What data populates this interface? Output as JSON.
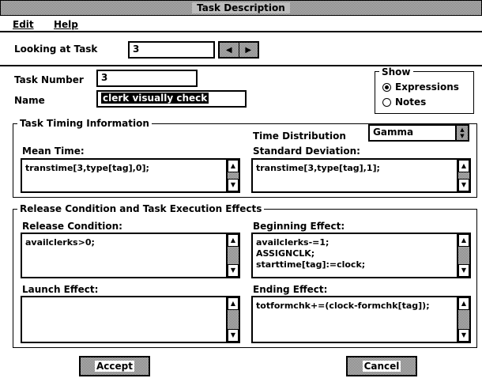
{
  "window": {
    "title": "Task Description"
  },
  "menu": {
    "edit": "Edit",
    "help": "Help"
  },
  "looking": {
    "label": "Looking at Task",
    "value": "3"
  },
  "task_number": {
    "label": "Task Number",
    "value": "3"
  },
  "name": {
    "label": "Name",
    "value": "clerk visually check"
  },
  "show": {
    "label": "Show",
    "options": [
      "Expressions",
      "Notes"
    ],
    "selected": "Expressions"
  },
  "timing": {
    "title": "Task Timing Information",
    "dist_label": "Time Distribution",
    "dist_value": "Gamma",
    "mean_label": "Mean Time:",
    "mean_value": "transtime[3,type[tag],0];",
    "std_label": "Standard Deviation:",
    "std_value": "transtime[3,type[tag],1];"
  },
  "release": {
    "title": "Release Condition and Task Execution Effects",
    "cond_label": "Release Condition:",
    "cond_value": "availclerks>0;",
    "begin_label": "Beginning Effect:",
    "begin_lines": [
      "availclerks-=1;",
      "ASSIGNCLK;",
      "starttime[tag]:=clock;"
    ],
    "launch_label": "Launch Effect:",
    "launch_value": "",
    "end_label": "Ending Effect:",
    "end_value": "totformchk+=(clock-formchk[tag]);"
  },
  "buttons": {
    "accept": "Accept",
    "cancel": "Cancel"
  }
}
